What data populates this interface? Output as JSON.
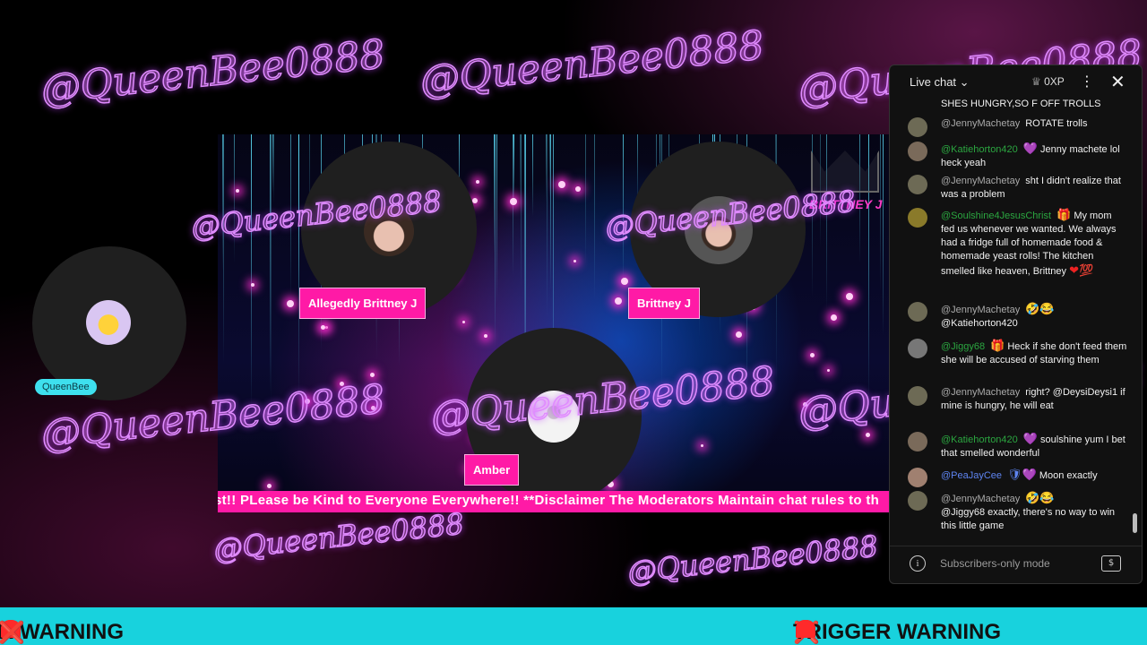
{
  "stream": {
    "watermark": "@QueenBee0888",
    "ticker": "st!! PLease be Kind to Everyone Everywhere!! **Disclaimer The Moderators Maintain chat rules to th",
    "brittney_logo": "BRITTNEY J",
    "participants": {
      "queen": "QueenBee",
      "allegedly": "Allegedly Brittney J",
      "brittney": "Brittney J",
      "amber": "Amber"
    }
  },
  "chat": {
    "title": "Live chat",
    "xp": "0XP",
    "partial_top": "SHES HUNGRY,SO F OFF TROLLS",
    "messages": [
      {
        "author": "@JennyMachetay",
        "text": "ROTATE trolls"
      },
      {
        "author": "@Katiehorton420",
        "text": "Jenny machete lol heck yeah"
      },
      {
        "author": "@JennyMachetay",
        "text": "sht I didn't realize that was a problem"
      },
      {
        "author": "@Soulshine4JesusChrist",
        "text": "My mom fed us whenever we wanted. We always had a fridge full of homemade food & homemade yeast rolls! The kitchen smelled like heaven, Brittney"
      },
      {
        "author": "@JennyMachetay",
        "text": "@Katiehorton420"
      },
      {
        "author": "@Jiggy68",
        "text": "Heck if she don't feed them she will be accused of starving them"
      },
      {
        "author": "@JennyMachetay",
        "text": "right? @DeysiDeysi1 if mine is hungry, he will eat"
      },
      {
        "author": "@Katiehorton420",
        "text": "soulshine yum I bet that smelled wonderful"
      },
      {
        "author": "@PeaJayCee",
        "text": "Moon exactly"
      },
      {
        "author": "@JennyMachetay",
        "text": "@Jiggy68 exactly, there's no way to win this little game"
      }
    ],
    "footer": "Subscribers-only mode"
  },
  "banner": {
    "left": "R WARNING",
    "right": "TRIGGER WARNING"
  },
  "icons": {
    "info": "info-icon",
    "close": "close-icon",
    "money": "super-chat-icon",
    "siren": "siren-icon"
  }
}
